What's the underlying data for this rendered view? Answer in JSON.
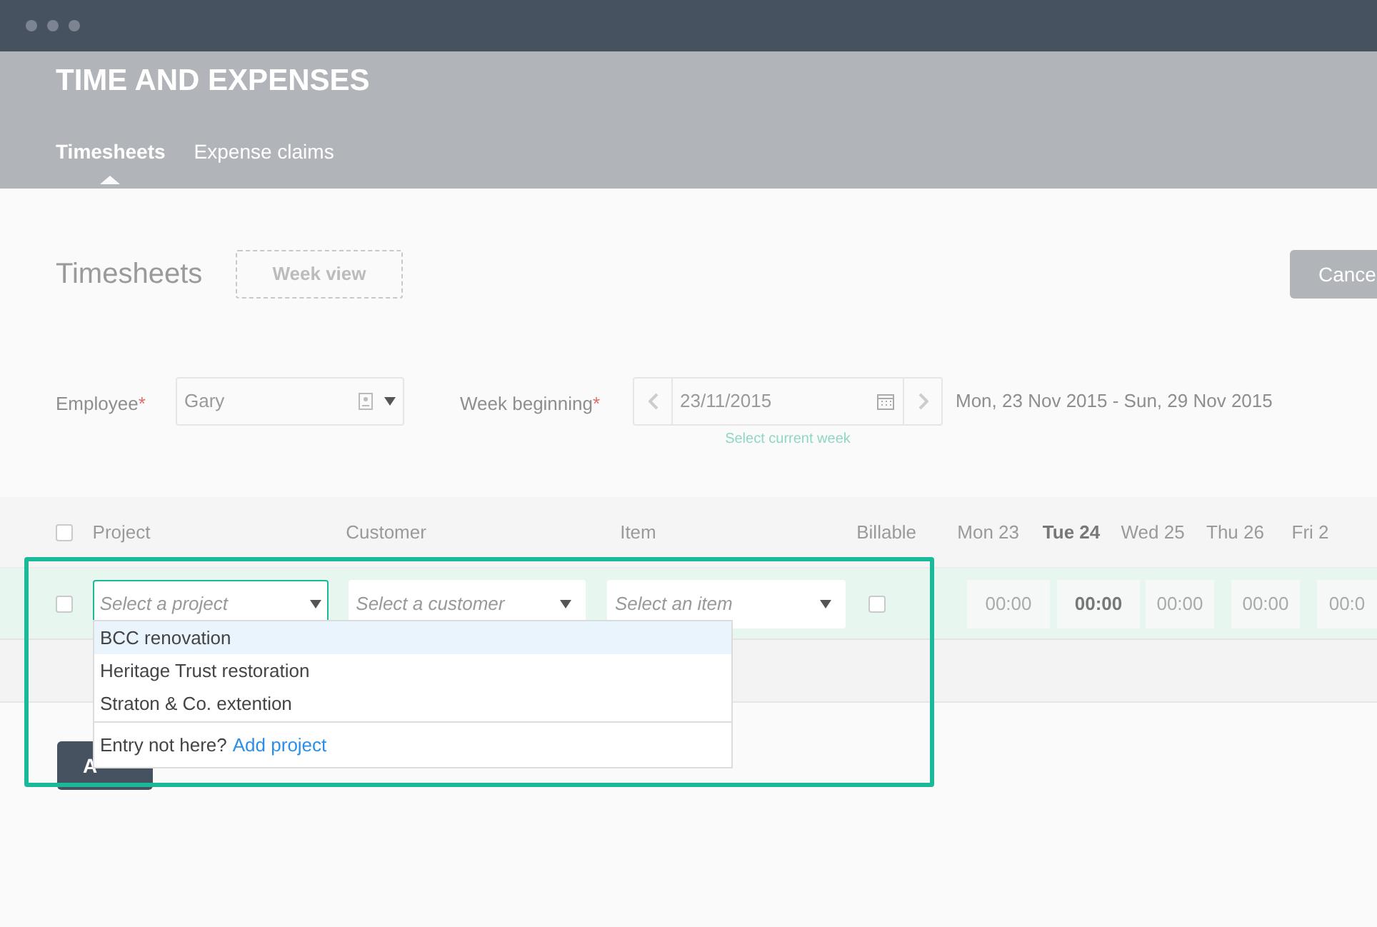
{
  "app_title": "TIME AND EXPENSES",
  "tabs": [
    {
      "label": "Timesheets",
      "selected": true
    },
    {
      "label": "Expense claims",
      "selected": false
    }
  ],
  "page_title": "Timesheets",
  "week_view_button": "Week view",
  "cancel_button": "Cance",
  "filters": {
    "employee": {
      "label": "Employee",
      "required_mark": "*",
      "value": "Gary"
    },
    "week_beginning": {
      "label": "Week beginning",
      "required_mark": "*",
      "value": "23/11/2015",
      "link": "Select current week"
    },
    "week_range": "Mon, 23 Nov 2015 - Sun, 29 Nov 2015"
  },
  "table": {
    "columns": [
      "Project",
      "Customer",
      "Item",
      "Billable"
    ],
    "days": [
      {
        "label": "Mon 23",
        "current": false
      },
      {
        "label": "Tue 24",
        "current": true
      },
      {
        "label": "Wed 25",
        "current": false
      },
      {
        "label": "Thu 26",
        "current": false
      },
      {
        "label": "Fri 2",
        "current": false
      }
    ],
    "header_checked": false,
    "row": {
      "checked": false,
      "project_placeholder": "Select a project",
      "customer_placeholder": "Select a customer",
      "item_placeholder": "Select an item",
      "billable": false,
      "times": [
        {
          "value": "00:00"
        },
        {
          "value": "00:00"
        },
        {
          "value": "00:00"
        },
        {
          "value": "00:00"
        },
        {
          "value": "00:0"
        }
      ]
    }
  },
  "dropdown": {
    "options": [
      {
        "label": "BCC renovation",
        "selected": true
      },
      {
        "label": "Heritage Trust restoration",
        "selected": false
      },
      {
        "label": "Straton & Co. extention",
        "selected": false
      }
    ],
    "footer_text": "Entry not here?",
    "footer_link": "Add project"
  },
  "add_button": "A"
}
